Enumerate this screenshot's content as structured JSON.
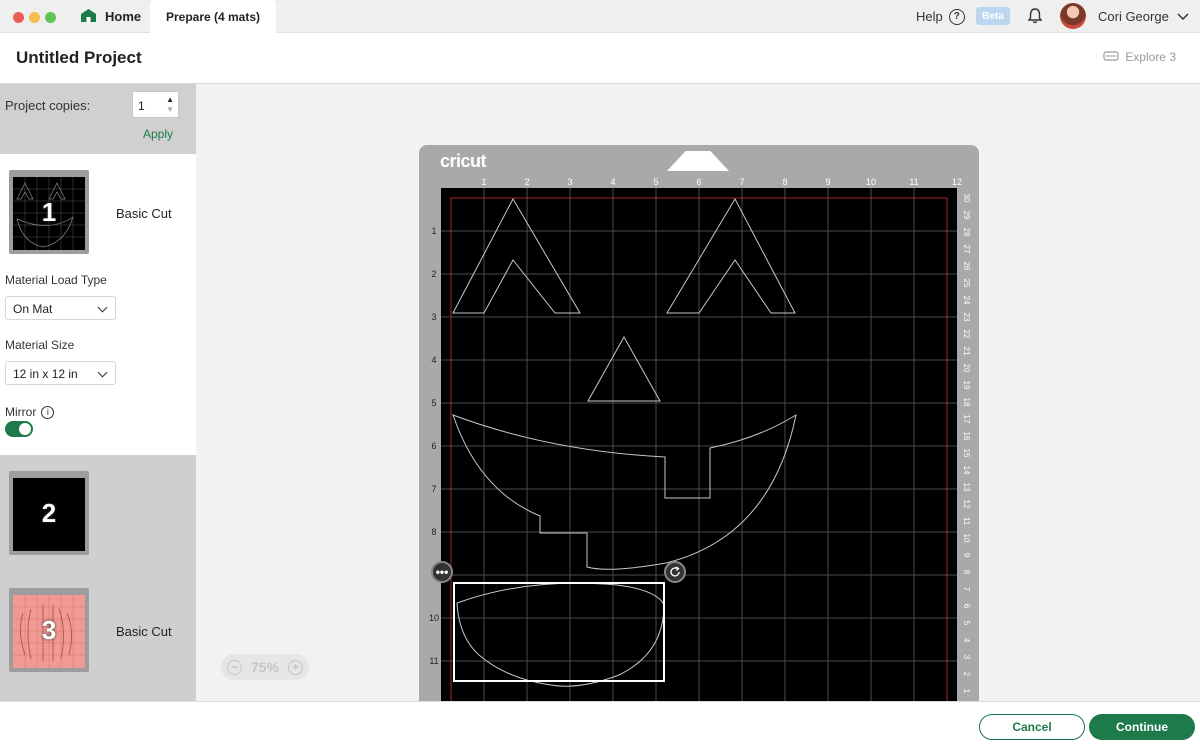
{
  "window": {
    "tabs": {
      "home": "Home",
      "prepare": "Prepare (4 mats)"
    },
    "help": "Help",
    "beta": "Beta",
    "user": "Cori George"
  },
  "header": {
    "title": "Untitled Project",
    "machine": "Explore 3"
  },
  "sidebar": {
    "copies_label": "Project copies:",
    "copies_value": "1",
    "apply": "Apply",
    "mats": [
      {
        "number": "1",
        "label": "Basic Cut",
        "selected": true
      },
      {
        "number": "2",
        "label": "",
        "selected": false
      },
      {
        "number": "3",
        "label": "Basic Cut",
        "selected": false
      }
    ],
    "load_type_label": "Material Load Type",
    "load_type_value": "On Mat",
    "size_label": "Material Size",
    "size_value": "12 in x 12 in",
    "mirror_label": "Mirror",
    "mirror_on": true
  },
  "canvas": {
    "brand": "cricut",
    "top_ruler": [
      "1",
      "2",
      "3",
      "4",
      "5",
      "6",
      "7",
      "8",
      "9",
      "10",
      "11",
      "12"
    ],
    "left_ruler": [
      "1",
      "2",
      "3",
      "4",
      "5",
      "6",
      "7",
      "8",
      "9",
      "10",
      "11"
    ],
    "right_ruler": [
      "30",
      "29",
      "28",
      "27",
      "26",
      "25",
      "24",
      "23",
      "22",
      "21",
      "20",
      "19",
      "18",
      "17",
      "16",
      "15",
      "14",
      "13",
      "12",
      "11",
      "10",
      "9",
      "8",
      "7",
      "6",
      "5",
      "4",
      "3",
      "2",
      "1"
    ],
    "zoom": "75%"
  },
  "footer": {
    "cancel": "Cancel",
    "continue": "Continue"
  },
  "colors": {
    "accent": "#1d7a4a",
    "mat_frame": "#a9a9a9",
    "mat_surface": "#000000",
    "cut_line": "#c8c8c8",
    "margin_line": "#c83232",
    "mat3_color": "#f19a93"
  }
}
